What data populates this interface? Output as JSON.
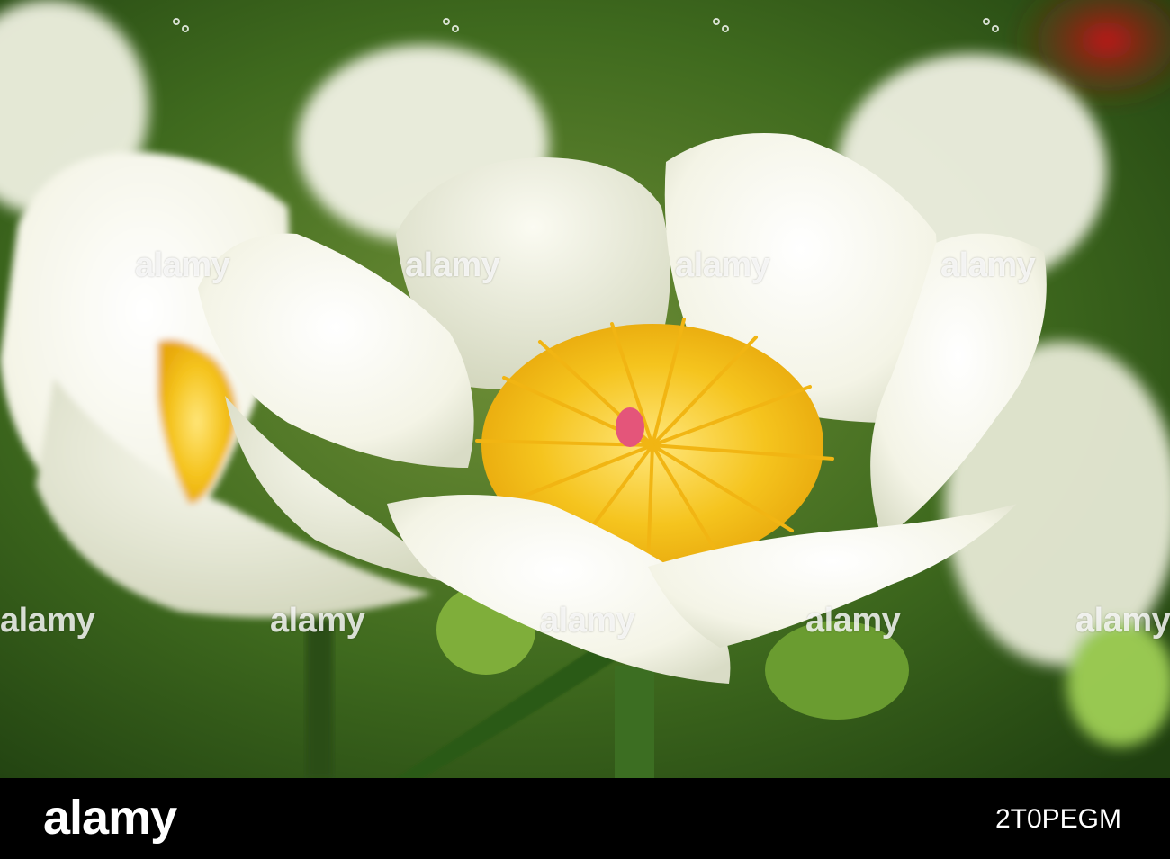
{
  "photo": {
    "subject": "white-peony-flower",
    "colors": {
      "background_green": "#3f6a1e",
      "petal_white": "#f6f6ea",
      "stamen_yellow": "#f2c21c",
      "accent_red": "#b01414"
    }
  },
  "watermark": {
    "text": "alamy"
  },
  "footer": {
    "brand": "alamy",
    "image_id": "2T0PEGM"
  }
}
